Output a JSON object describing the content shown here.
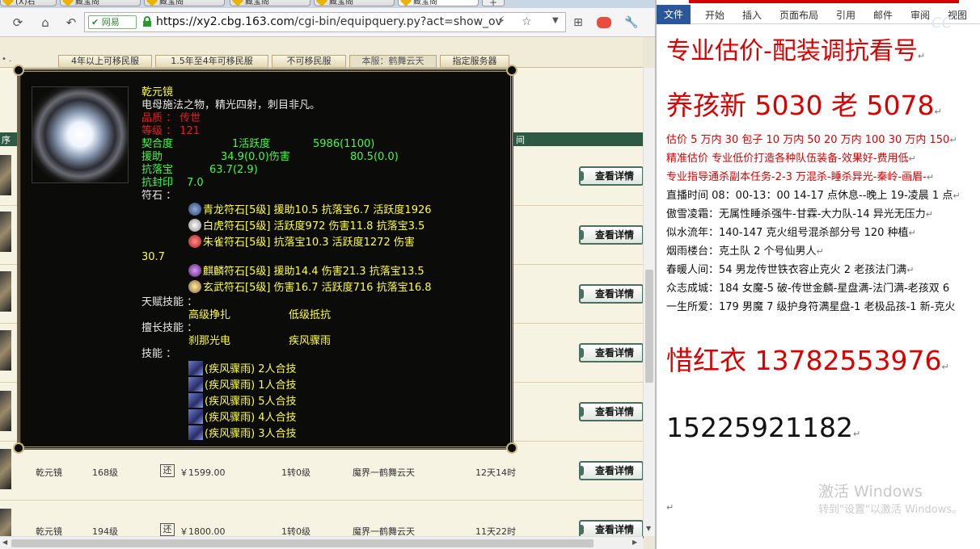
{
  "browser": {
    "tabs": [
      "(X)右",
      "藏宝阁",
      "藏宝阁",
      "藏宝阁",
      "藏宝阁",
      "藏宝阁"
    ],
    "newtab": "+",
    "cert": "网易",
    "url_domain": "https://xy2.cbg.163.com",
    "url_path": "/cgi-bin/equipquery.py?act=show_ov",
    "dropdown": "▼"
  },
  "filters": {
    "tabs": [
      "4年以上可移民服",
      "1.5年至4年可移民服",
      "不可移民服",
      "本服：鹤舞云天",
      "指定服务器"
    ],
    "left_dots": "• ."
  },
  "list": {
    "head_left": "序",
    "head_right": "间",
    "detail_label": "查看详情",
    "rows": [
      {
        "name": "乾元镜",
        "level": "168级",
        "huan": "还",
        "price": "￥1599.00",
        "zhuan": "1转0级",
        "server": "魔界一鹤舞云天",
        "time": "12天14时"
      },
      {
        "name": "乾元镜",
        "level": "194级",
        "huan": "还",
        "price": "￥1800.00",
        "zhuan": "1转0级",
        "server": "魔界一鹤舞云天",
        "time": "11天22时"
      }
    ]
  },
  "popup": {
    "title": "乾元镜",
    "desc": "电母施法之物，精光四射，刺目非凡。",
    "quality": "品质 ： 传世",
    "level": "等级 ： 121",
    "stat1_label": "契合度",
    "stat1_mid": "1活跃度",
    "stat1_val": "5986(1100)",
    "stat2_label": "援助",
    "stat2_val": "34.9(0.0)伤害",
    "stat2_val2": "80.5(0.0)",
    "stat3_label": "抗落宝",
    "stat3_val": "63.7(2.9)",
    "stat4_label": "抗封印",
    "stat4_val": "7.0",
    "rune_label": "符石 ：",
    "runes": [
      "青龙符石[5级] 援助10.5  抗落宝6.7  活跃度1926",
      "白虎符石[5级] 活跃度972  伤害11.8  抗落宝3.5",
      "朱雀符石[5级] 抗落宝10.3  活跃度1272  伤害",
      "麒麟符石[5级] 援助14.4  伤害21.3  抗落宝13.5",
      "玄武符石[5级] 伤害16.7  活跃度716  抗落宝16.8"
    ],
    "rune_wrap": "30.7",
    "talent_label": "天赋技能 ：",
    "talents": [
      "高级挣扎",
      "低级抵抗"
    ],
    "expert_label": "擅长技能 ：",
    "experts": [
      "刹那光电",
      "疾风骤雨"
    ],
    "skill_label": "技能 ：",
    "skills": [
      "(疾风骤雨)  2人合技",
      "(疾风骤雨)  1人合技",
      "(疾风骤雨)  5人合技",
      "(疾风骤雨)  4人合技",
      "(疾风骤雨)  3人合技"
    ]
  },
  "word": {
    "ribbon": [
      "文件",
      "开始",
      "插入",
      "页面布局",
      "引用",
      "邮件",
      "审阅",
      "视图"
    ],
    "lines": [
      "专业估价-配装调抗看号",
      "养孩新 5030 老 5078",
      "估价 5 万内 30 包子  10 万内 50  20 万内 100  30 万内 150",
      "精准估价  专业低价打造各种队伍装备-效果好-费用低",
      "专业指导通杀副本任务-2-3 万混杀-睡杀异光-秦岭-画眉-",
      "直播时间 08：00-13：00 14-17 点休息--晚上 19-凌晨 1 点",
      "傲雪凌霜：无属性睡杀强牛-甘霖-大力队-14 异光无压力",
      "似水流年：140-147 克火组号混杀部分号 120 种植",
      "烟雨楼台：克土队 2 个号仙男人",
      "春暖人间：54 男龙传世铁衣容止克火 2 老孩法门满",
      "众志成城：184 女魔-5 破-传世金麟-星盘满-法门满-老孩双 6",
      "一生所爱：179 男魔 7 级护身符满星盘-1 老极品孩-1 新-克火",
      "惜红衣 13782553976",
      "15225921182"
    ],
    "watermark": "激活 Windows",
    "watermark2": "转到\"设置\"以激活 Windows。"
  },
  "colors": {
    "popup_bg": "#0b0b09",
    "yellow": "#ffff40",
    "red": "#e02020",
    "green": "#40ff40",
    "doc_red": "#d80000",
    "header_green": "#2e5a44"
  }
}
